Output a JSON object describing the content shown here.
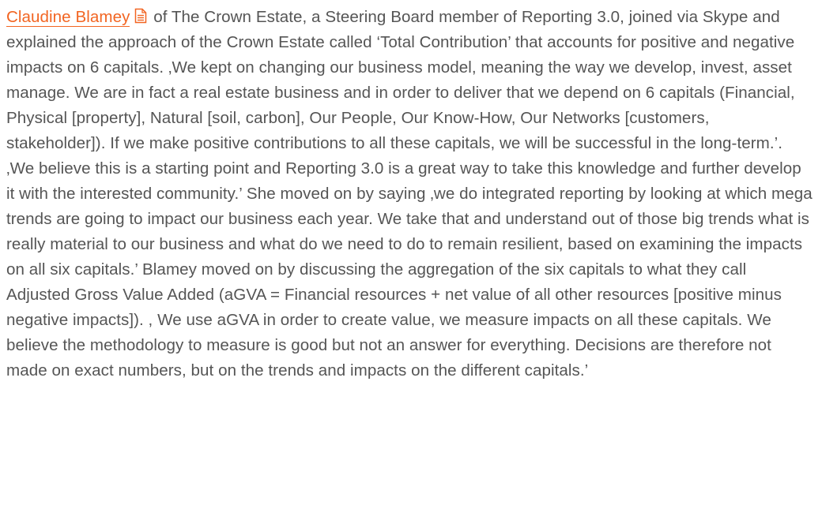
{
  "article": {
    "author_link": "Claudine Blamey",
    "author_icon": "document-icon",
    "body_text": " of The Crown Estate, a Steering Board member of Reporting 3.0, joined via Skype and explained the approach of the Crown Estate called ‘Total Contribution’ that accounts for positive and negative impacts on 6 capitals. ‚We kept on changing our business model, meaning the way we develop, invest, asset manage. We are in fact a real estate business and in order to deliver that we depend on 6 capitals (Financial, Physical [property], Natural [soil, carbon], Our People, Our Know-How, Our Networks [customers, stakeholder]). If we make positive contributions to all these capitals, we will be successful in the long-term.’. ‚We believe this is a starting point and Reporting 3.0 is a great way to take this knowledge and further develop it with the interested community.’ She moved on by saying ‚we do integrated reporting by looking at which mega trends are going to impact our business each year. We take that and understand out of those big trends what is really material to our business and what do we need to do to remain resilient, based on examining the impacts on all six capitals.’ Blamey moved on by discussing the aggregation of the six capitals to what they call Adjusted Gross Value Added (aGVA = Financial resources + net value of all other resources [positive minus negative impacts]). , We use aGVA in order to create value, we measure impacts on all these capitals. We believe the methodology to measure is good but not an answer for everything. Decisions are therefore not made on exact numbers, but on the trends and impacts on the different capitals.’"
  },
  "colors": {
    "link": "#f26522",
    "text": "#555555",
    "background": "#ffffff"
  }
}
